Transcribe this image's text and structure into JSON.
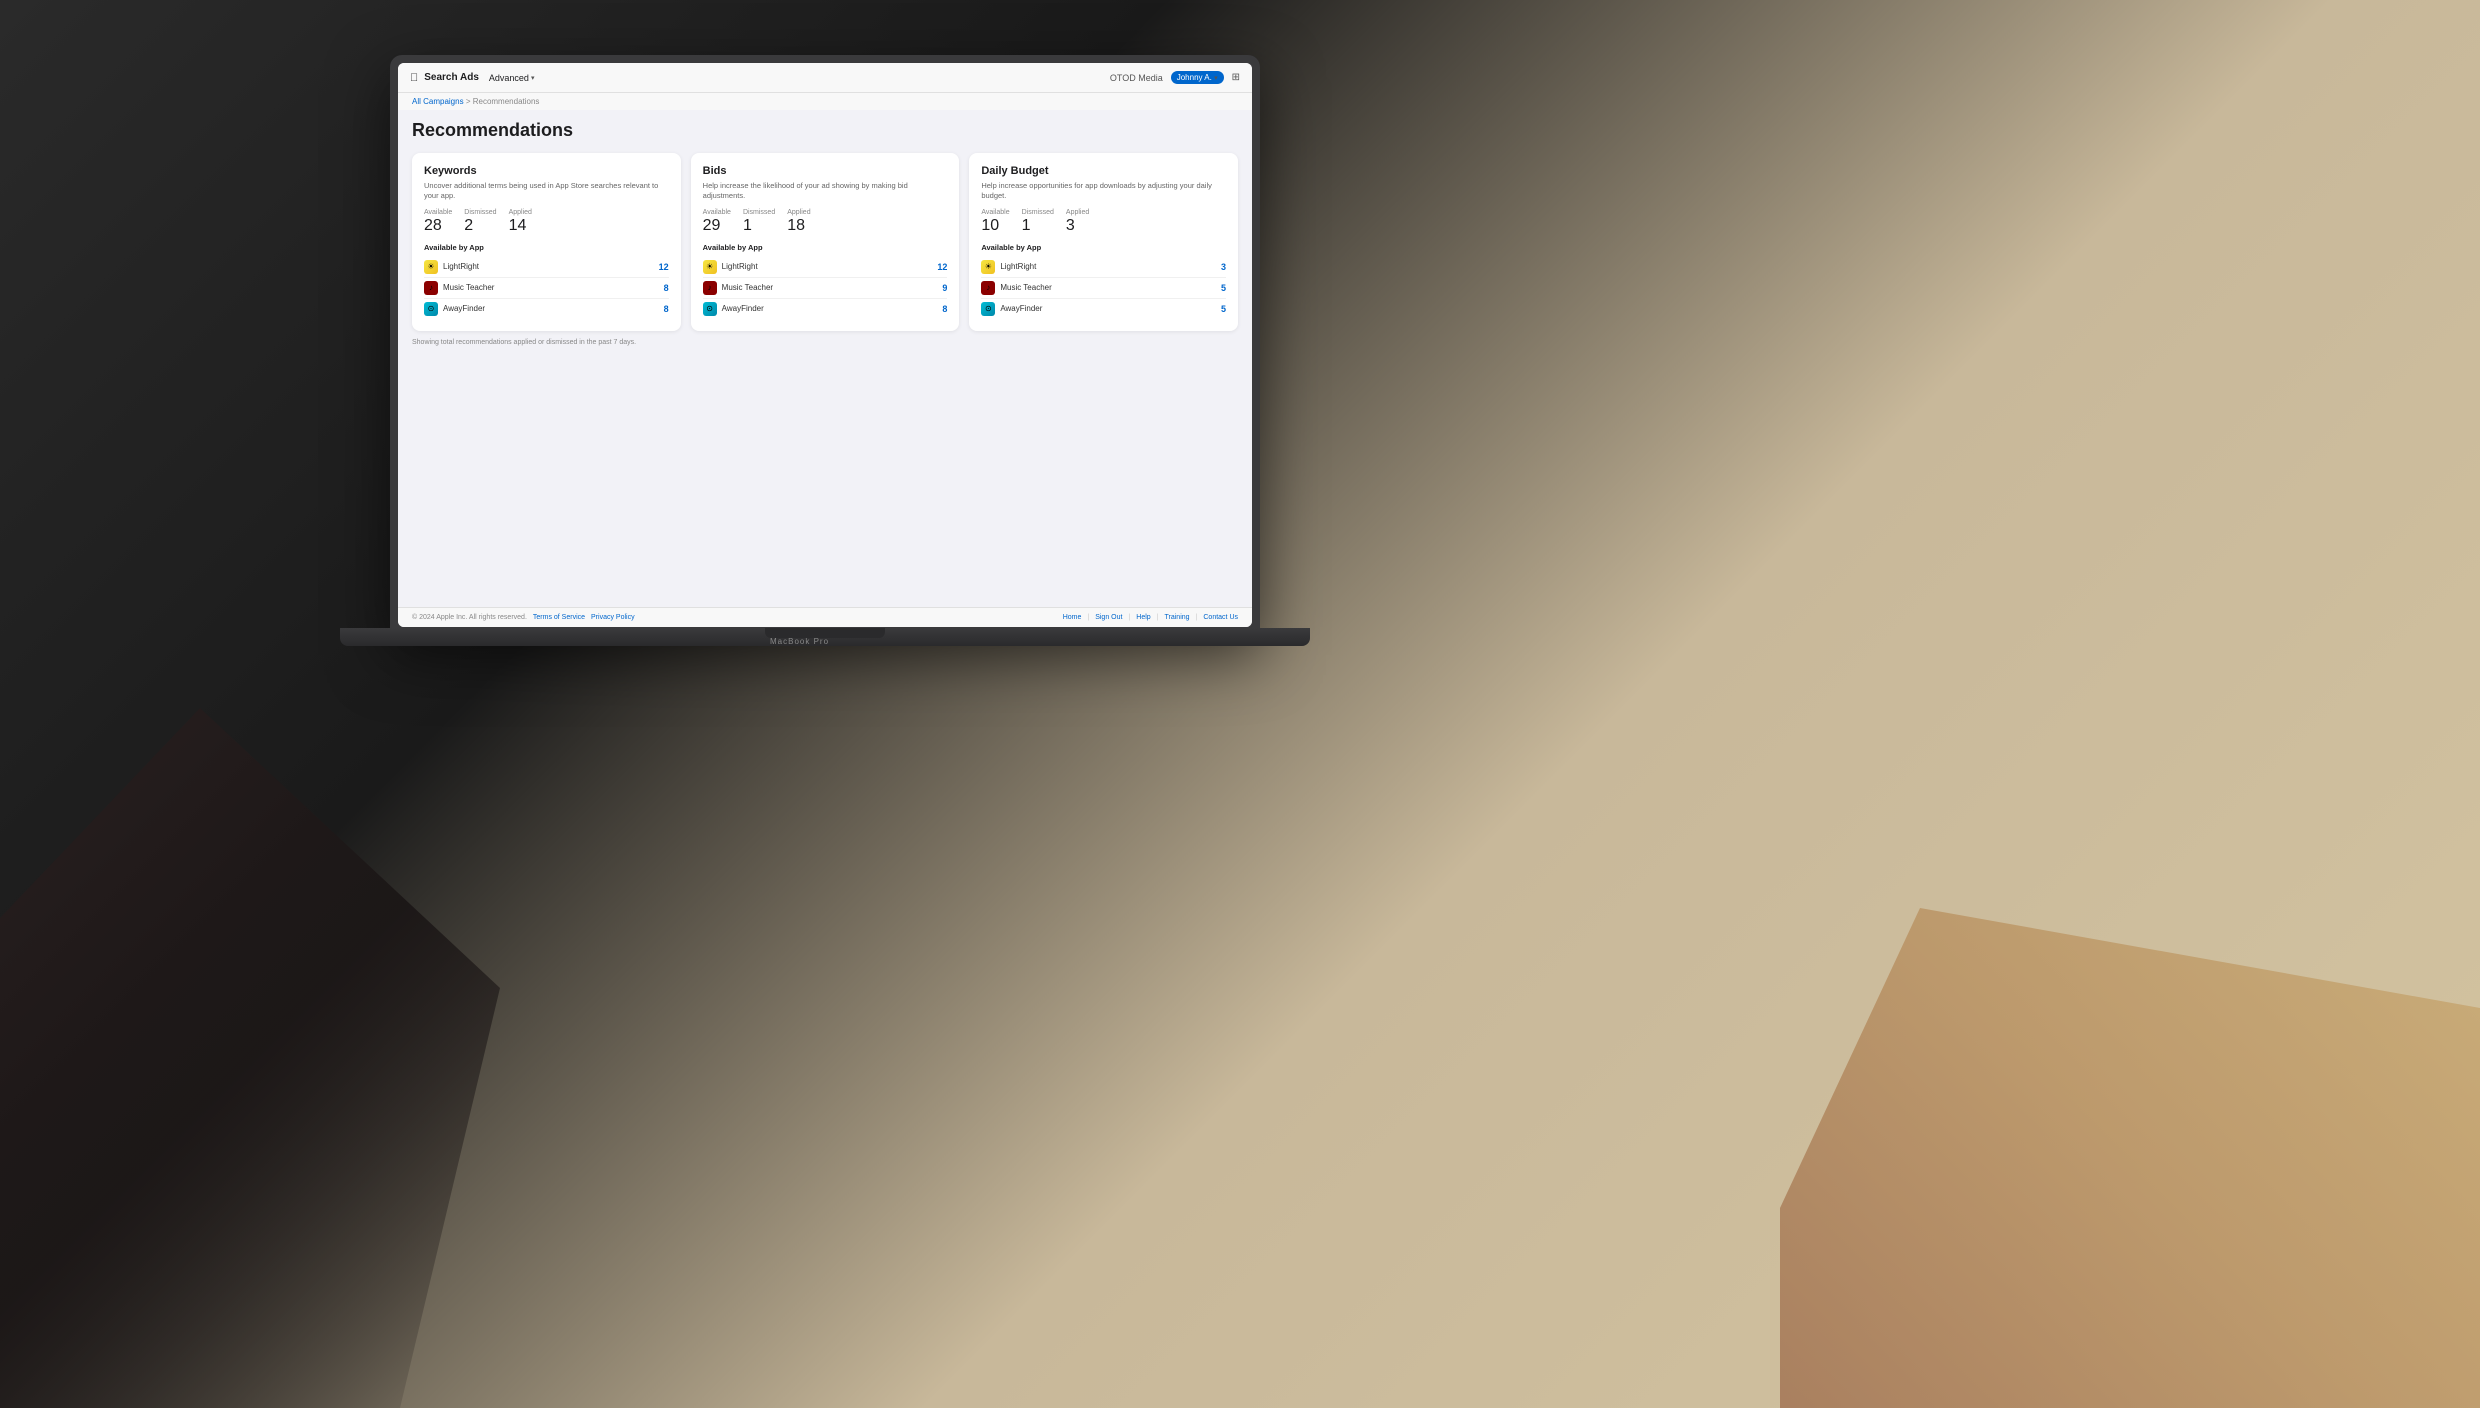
{
  "meta": {
    "dimensions": "2480x1408"
  },
  "nav": {
    "brand": "Search Ads",
    "advanced_label": "Advanced",
    "org_name": "OTOD Media",
    "user_name": "Johnny A.",
    "layout_icon": "⊞"
  },
  "breadcrumb": {
    "all_campaigns": "All Campaigns",
    "separator": ">",
    "current": "Recommendations"
  },
  "page": {
    "title": "Recommendations"
  },
  "cards": [
    {
      "id": "keywords",
      "title": "Keywords",
      "description": "Uncover additional terms being used in App Store searches relevant to your app.",
      "stats": {
        "available_label": "Available",
        "available_value": "28",
        "dismissed_label": "Dismissed",
        "dismissed_value": "2",
        "applied_label": "Applied",
        "applied_value": "14"
      },
      "available_by_app_label": "Available by App",
      "apps": [
        {
          "id": "lightright",
          "name": "LightRight",
          "count": "12"
        },
        {
          "id": "musicteacher",
          "name": "Music Teacher",
          "count": "8"
        },
        {
          "id": "awayfinder",
          "name": "AwayFinder",
          "count": "8"
        }
      ]
    },
    {
      "id": "bids",
      "title": "Bids",
      "description": "Help increase the likelihood of your ad showing by making bid adjustments.",
      "stats": {
        "available_label": "Available",
        "available_value": "29",
        "dismissed_label": "Dismissed",
        "dismissed_value": "1",
        "applied_label": "Applied",
        "applied_value": "18"
      },
      "available_by_app_label": "Available by App",
      "apps": [
        {
          "id": "lightright",
          "name": "LightRight",
          "count": "12"
        },
        {
          "id": "musicteacher",
          "name": "Music Teacher",
          "count": "9"
        },
        {
          "id": "awayfinder",
          "name": "AwayFinder",
          "count": "8"
        }
      ]
    },
    {
      "id": "daily-budget",
      "title": "Daily Budget",
      "description": "Help increase opportunities for app downloads by adjusting your daily budget.",
      "stats": {
        "available_label": "Available",
        "available_value": "10",
        "dismissed_label": "Dismissed",
        "dismissed_value": "1",
        "applied_label": "Applied",
        "applied_value": "3"
      },
      "available_by_app_label": "Available by App",
      "apps": [
        {
          "id": "lightright",
          "name": "LightRight",
          "count": "3"
        },
        {
          "id": "musicteacher",
          "name": "Music Teacher",
          "count": "5"
        },
        {
          "id": "awayfinder",
          "name": "AwayFinder",
          "count": "5"
        }
      ]
    }
  ],
  "footer_note": "Showing total recommendations applied or dismissed in the past 7 days.",
  "footer": {
    "copyright": "© 2024 Apple Inc. All rights reserved.",
    "links": [
      "Terms of Service",
      "Privacy Policy"
    ],
    "nav_links": [
      "Home",
      "Sign Out",
      "Help",
      "Training",
      "Contact Us"
    ]
  }
}
